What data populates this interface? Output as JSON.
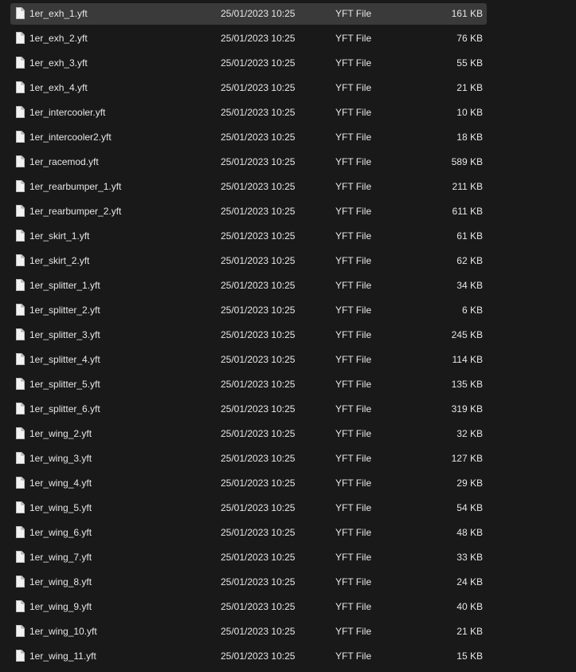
{
  "files": [
    {
      "name": "1er_exh_1.yft",
      "modified": "25/01/2023 10:25",
      "type": "YFT File",
      "size": "161 KB",
      "selected": true
    },
    {
      "name": "1er_exh_2.yft",
      "modified": "25/01/2023 10:25",
      "type": "YFT File",
      "size": "76 KB"
    },
    {
      "name": "1er_exh_3.yft",
      "modified": "25/01/2023 10:25",
      "type": "YFT File",
      "size": "55 KB"
    },
    {
      "name": "1er_exh_4.yft",
      "modified": "25/01/2023 10:25",
      "type": "YFT File",
      "size": "21 KB"
    },
    {
      "name": "1er_intercooler.yft",
      "modified": "25/01/2023 10:25",
      "type": "YFT File",
      "size": "10 KB"
    },
    {
      "name": "1er_intercooler2.yft",
      "modified": "25/01/2023 10:25",
      "type": "YFT File",
      "size": "18 KB"
    },
    {
      "name": "1er_racemod.yft",
      "modified": "25/01/2023 10:25",
      "type": "YFT File",
      "size": "589 KB"
    },
    {
      "name": "1er_rearbumper_1.yft",
      "modified": "25/01/2023 10:25",
      "type": "YFT File",
      "size": "211 KB"
    },
    {
      "name": "1er_rearbumper_2.yft",
      "modified": "25/01/2023 10:25",
      "type": "YFT File",
      "size": "611 KB"
    },
    {
      "name": "1er_skirt_1.yft",
      "modified": "25/01/2023 10:25",
      "type": "YFT File",
      "size": "61 KB"
    },
    {
      "name": "1er_skirt_2.yft",
      "modified": "25/01/2023 10:25",
      "type": "YFT File",
      "size": "62 KB"
    },
    {
      "name": "1er_splitter_1.yft",
      "modified": "25/01/2023 10:25",
      "type": "YFT File",
      "size": "34 KB"
    },
    {
      "name": "1er_splitter_2.yft",
      "modified": "25/01/2023 10:25",
      "type": "YFT File",
      "size": "6 KB"
    },
    {
      "name": "1er_splitter_3.yft",
      "modified": "25/01/2023 10:25",
      "type": "YFT File",
      "size": "245 KB"
    },
    {
      "name": "1er_splitter_4.yft",
      "modified": "25/01/2023 10:25",
      "type": "YFT File",
      "size": "114 KB"
    },
    {
      "name": "1er_splitter_5.yft",
      "modified": "25/01/2023 10:25",
      "type": "YFT File",
      "size": "135 KB"
    },
    {
      "name": "1er_splitter_6.yft",
      "modified": "25/01/2023 10:25",
      "type": "YFT File",
      "size": "319 KB"
    },
    {
      "name": "1er_wing_2.yft",
      "modified": "25/01/2023 10:25",
      "type": "YFT File",
      "size": "32 KB"
    },
    {
      "name": "1er_wing_3.yft",
      "modified": "25/01/2023 10:25",
      "type": "YFT File",
      "size": "127 KB"
    },
    {
      "name": "1er_wing_4.yft",
      "modified": "25/01/2023 10:25",
      "type": "YFT File",
      "size": "29 KB"
    },
    {
      "name": "1er_wing_5.yft",
      "modified": "25/01/2023 10:25",
      "type": "YFT File",
      "size": "54 KB"
    },
    {
      "name": "1er_wing_6.yft",
      "modified": "25/01/2023 10:25",
      "type": "YFT File",
      "size": "48 KB"
    },
    {
      "name": "1er_wing_7.yft",
      "modified": "25/01/2023 10:25",
      "type": "YFT File",
      "size": "33 KB"
    },
    {
      "name": "1er_wing_8.yft",
      "modified": "25/01/2023 10:25",
      "type": "YFT File",
      "size": "24 KB"
    },
    {
      "name": "1er_wing_9.yft",
      "modified": "25/01/2023 10:25",
      "type": "YFT File",
      "size": "40 KB"
    },
    {
      "name": "1er_wing_10.yft",
      "modified": "25/01/2023 10:25",
      "type": "YFT File",
      "size": "21 KB"
    },
    {
      "name": "1er_wing_11.yft",
      "modified": "25/01/2023 10:25",
      "type": "YFT File",
      "size": "15 KB"
    }
  ],
  "icons": {
    "file": "file-icon"
  },
  "colors": {
    "background": "#191919",
    "selected_row": "#3a3a3a",
    "text": "#e6e6e6"
  }
}
